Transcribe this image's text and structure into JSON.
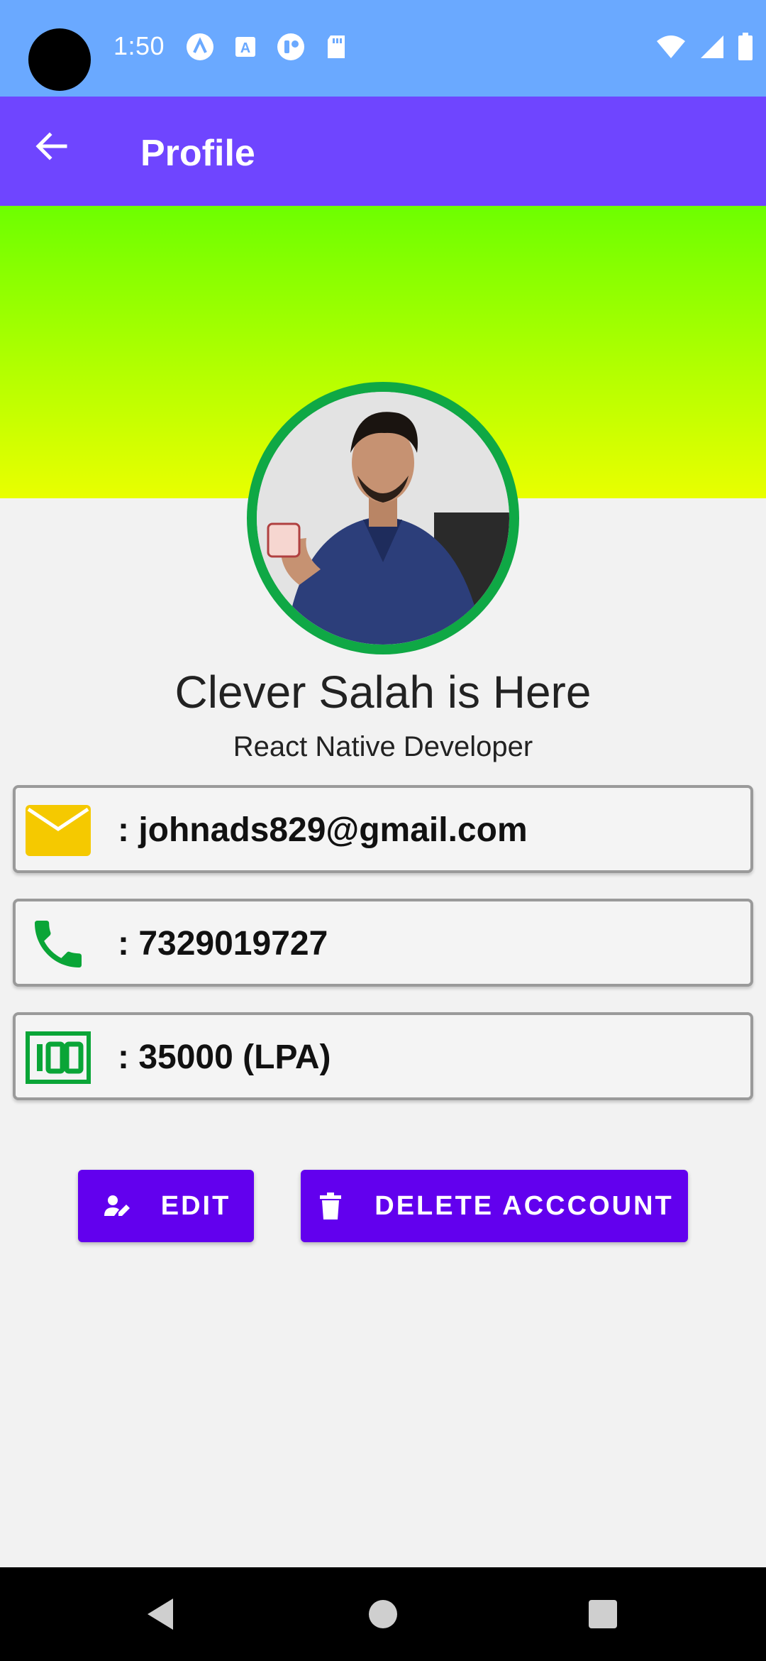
{
  "status_bar": {
    "time": "1:50",
    "notification_icons": [
      "a-icon",
      "translate-icon",
      "toggle-icon",
      "sd-card-icon"
    ],
    "system_icons": [
      "wifi-icon",
      "signal-icon",
      "battery-icon"
    ]
  },
  "app_bar": {
    "title": "Profile",
    "back_icon": "arrow-left-icon"
  },
  "colors": {
    "status_bar": "#6aa9ff",
    "app_bar": "#6f45ff",
    "banner_top": "#6dff00",
    "banner_bottom": "#e9ff00",
    "avatar_ring": "#0fa845",
    "button": "#6200ee"
  },
  "profile": {
    "name": "Clever Salah is Here",
    "role": "React Native Developer"
  },
  "info": [
    {
      "icon": "email-icon",
      "text": ": johnads829@gmail.com"
    },
    {
      "icon": "phone-icon",
      "text": ": 7329019727"
    },
    {
      "icon": "hundred-icon",
      "text": ": 35000 (LPA)"
    }
  ],
  "actions": {
    "edit_label": "EDIT",
    "delete_label": "DELETE ACCCOUNT"
  },
  "nav": [
    "back-triangle-icon",
    "home-circle-icon",
    "recents-square-icon"
  ]
}
